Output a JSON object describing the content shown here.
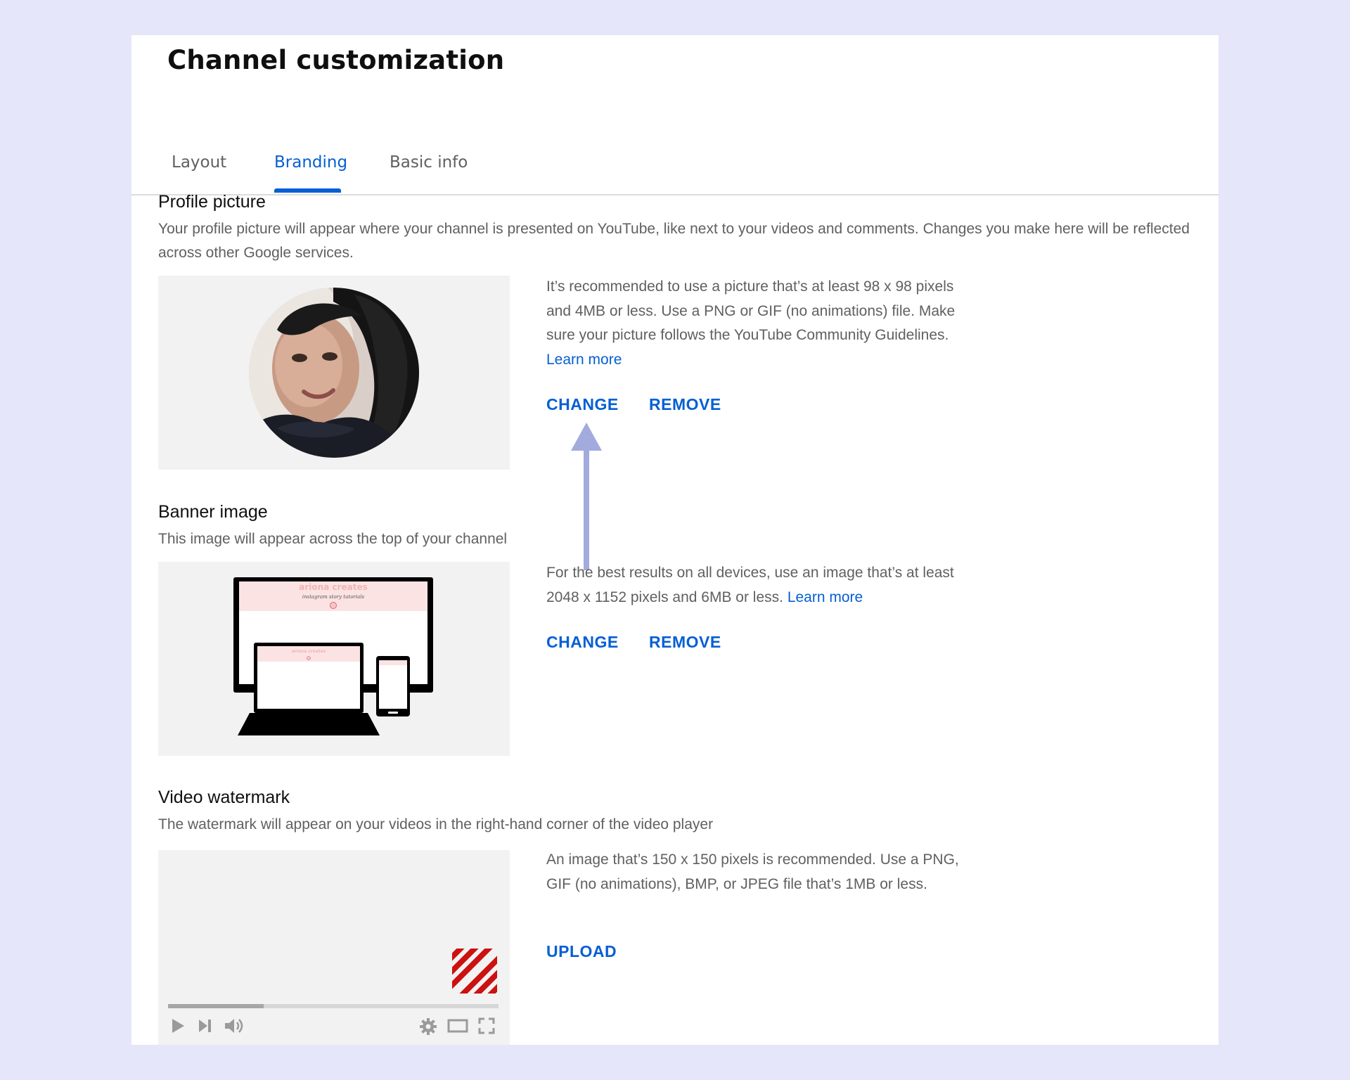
{
  "page": {
    "title": "Channel customization"
  },
  "tabs": [
    {
      "label": "Layout",
      "active": false
    },
    {
      "label": "Branding",
      "active": true
    },
    {
      "label": "Basic info",
      "active": false
    }
  ],
  "colors": {
    "accent": "#065fd4",
    "annotation_arrow": "#a3aadd",
    "watermark_stripes": "#cc1111"
  },
  "profile": {
    "title": "Profile picture",
    "description": "Your profile picture will appear where your channel is presented on YouTube, like next to your videos and comments. Changes you make here will be reflected across other Google services.",
    "info": "It’s recommended to use a picture that’s at least 98 x 98 pixels and 4MB or less. Use a PNG or GIF (no animations) file. Make sure your picture follows the YouTube Community Guidelines.",
    "learn_more": "Learn more",
    "change_label": "CHANGE",
    "remove_label": "REMOVE"
  },
  "banner": {
    "title": "Banner image",
    "description": "This image will appear across the top of your channel",
    "info": "For the best results on all devices, use an image that’s at least 2048 x 1152 pixels and 6MB or less.",
    "learn_more": "Learn more",
    "change_label": "CHANGE",
    "remove_label": "REMOVE",
    "mockup_brand": "ariona creates",
    "mockup_tagline": "instagram story tutorials"
  },
  "watermark": {
    "title": "Video watermark",
    "description": "The watermark will appear on your videos in the right-hand corner of the video player",
    "info": "An image that’s 150 x 150 pixels is recommended. Use a PNG, GIF (no animations), BMP, or JPEG file that’s 1MB or less.",
    "upload_label": "UPLOAD",
    "player_progress": 0.29,
    "player_icons": [
      "play-icon",
      "next-icon",
      "volume-icon",
      "settings-gear-icon",
      "theater-mode-icon",
      "fullscreen-icon"
    ]
  }
}
